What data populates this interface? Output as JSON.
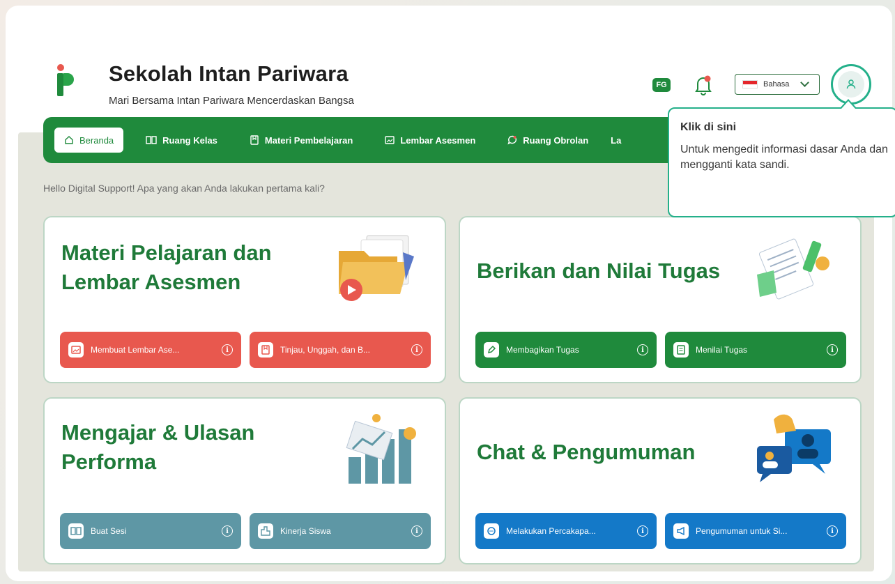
{
  "header": {
    "title": "Sekolah Intan Pariwara",
    "subtitle": "Mari Bersama Intan Pariwara Mencerdaskan Bangsa",
    "fg_label": "FG",
    "language_label": "Bahasa"
  },
  "nav": {
    "items": [
      {
        "label": "Beranda",
        "icon": "home-icon",
        "active": true
      },
      {
        "label": "Ruang Kelas",
        "icon": "book-icon"
      },
      {
        "label": "Materi Pembelajaran",
        "icon": "bookmark-icon"
      },
      {
        "label": "Lembar Asesmen",
        "icon": "image-icon"
      },
      {
        "label": "Ruang Obrolan",
        "icon": "chat-icon"
      },
      {
        "label": "La",
        "icon": ""
      }
    ]
  },
  "greeting": "Hello Digital Support! Apa yang akan Anda lakukan pertama kali?",
  "cards": [
    {
      "title": "Materi Pelajaran dan Lembar Asesmen",
      "title_line1": "Materi Pelajaran dan",
      "title_line2": "Lembar Asesmen",
      "buttons": [
        {
          "label": "Membuat Lembar Ase...",
          "color": "#e8584e"
        },
        {
          "label": "Tinjau, Unggah, dan B...",
          "color": "#e8584e"
        }
      ]
    },
    {
      "title": "Berikan dan Nilai Tugas",
      "buttons": [
        {
          "label": "Membagikan Tugas",
          "color": "#1f8a3c"
        },
        {
          "label": "Menilai Tugas",
          "color": "#1f8a3c"
        }
      ]
    },
    {
      "title_line1": "Mengajar & Ulasan",
      "title_line2": "Performa",
      "buttons": [
        {
          "label": "Buat Sesi",
          "color": "#5e97a5"
        },
        {
          "label": "Kinerja Siswa",
          "color": "#5e97a5"
        }
      ]
    },
    {
      "title": "Chat & Pengumuman",
      "buttons": [
        {
          "label": "Melakukan Percakapa...",
          "color": "#1479c8"
        },
        {
          "label": "Pengumuman untuk Si...",
          "color": "#1479c8"
        }
      ]
    }
  ],
  "tooltip": {
    "title": "Klik di sini",
    "body": "Untuk mengedit informasi dasar Anda dan mengganti kata sandi."
  },
  "info_glyph": "i",
  "colors": {
    "brand_green": "#1f8a3c",
    "accent_teal": "#24b08a",
    "red": "#e8584e",
    "blue": "#1479c8",
    "slate": "#5e97a5"
  }
}
